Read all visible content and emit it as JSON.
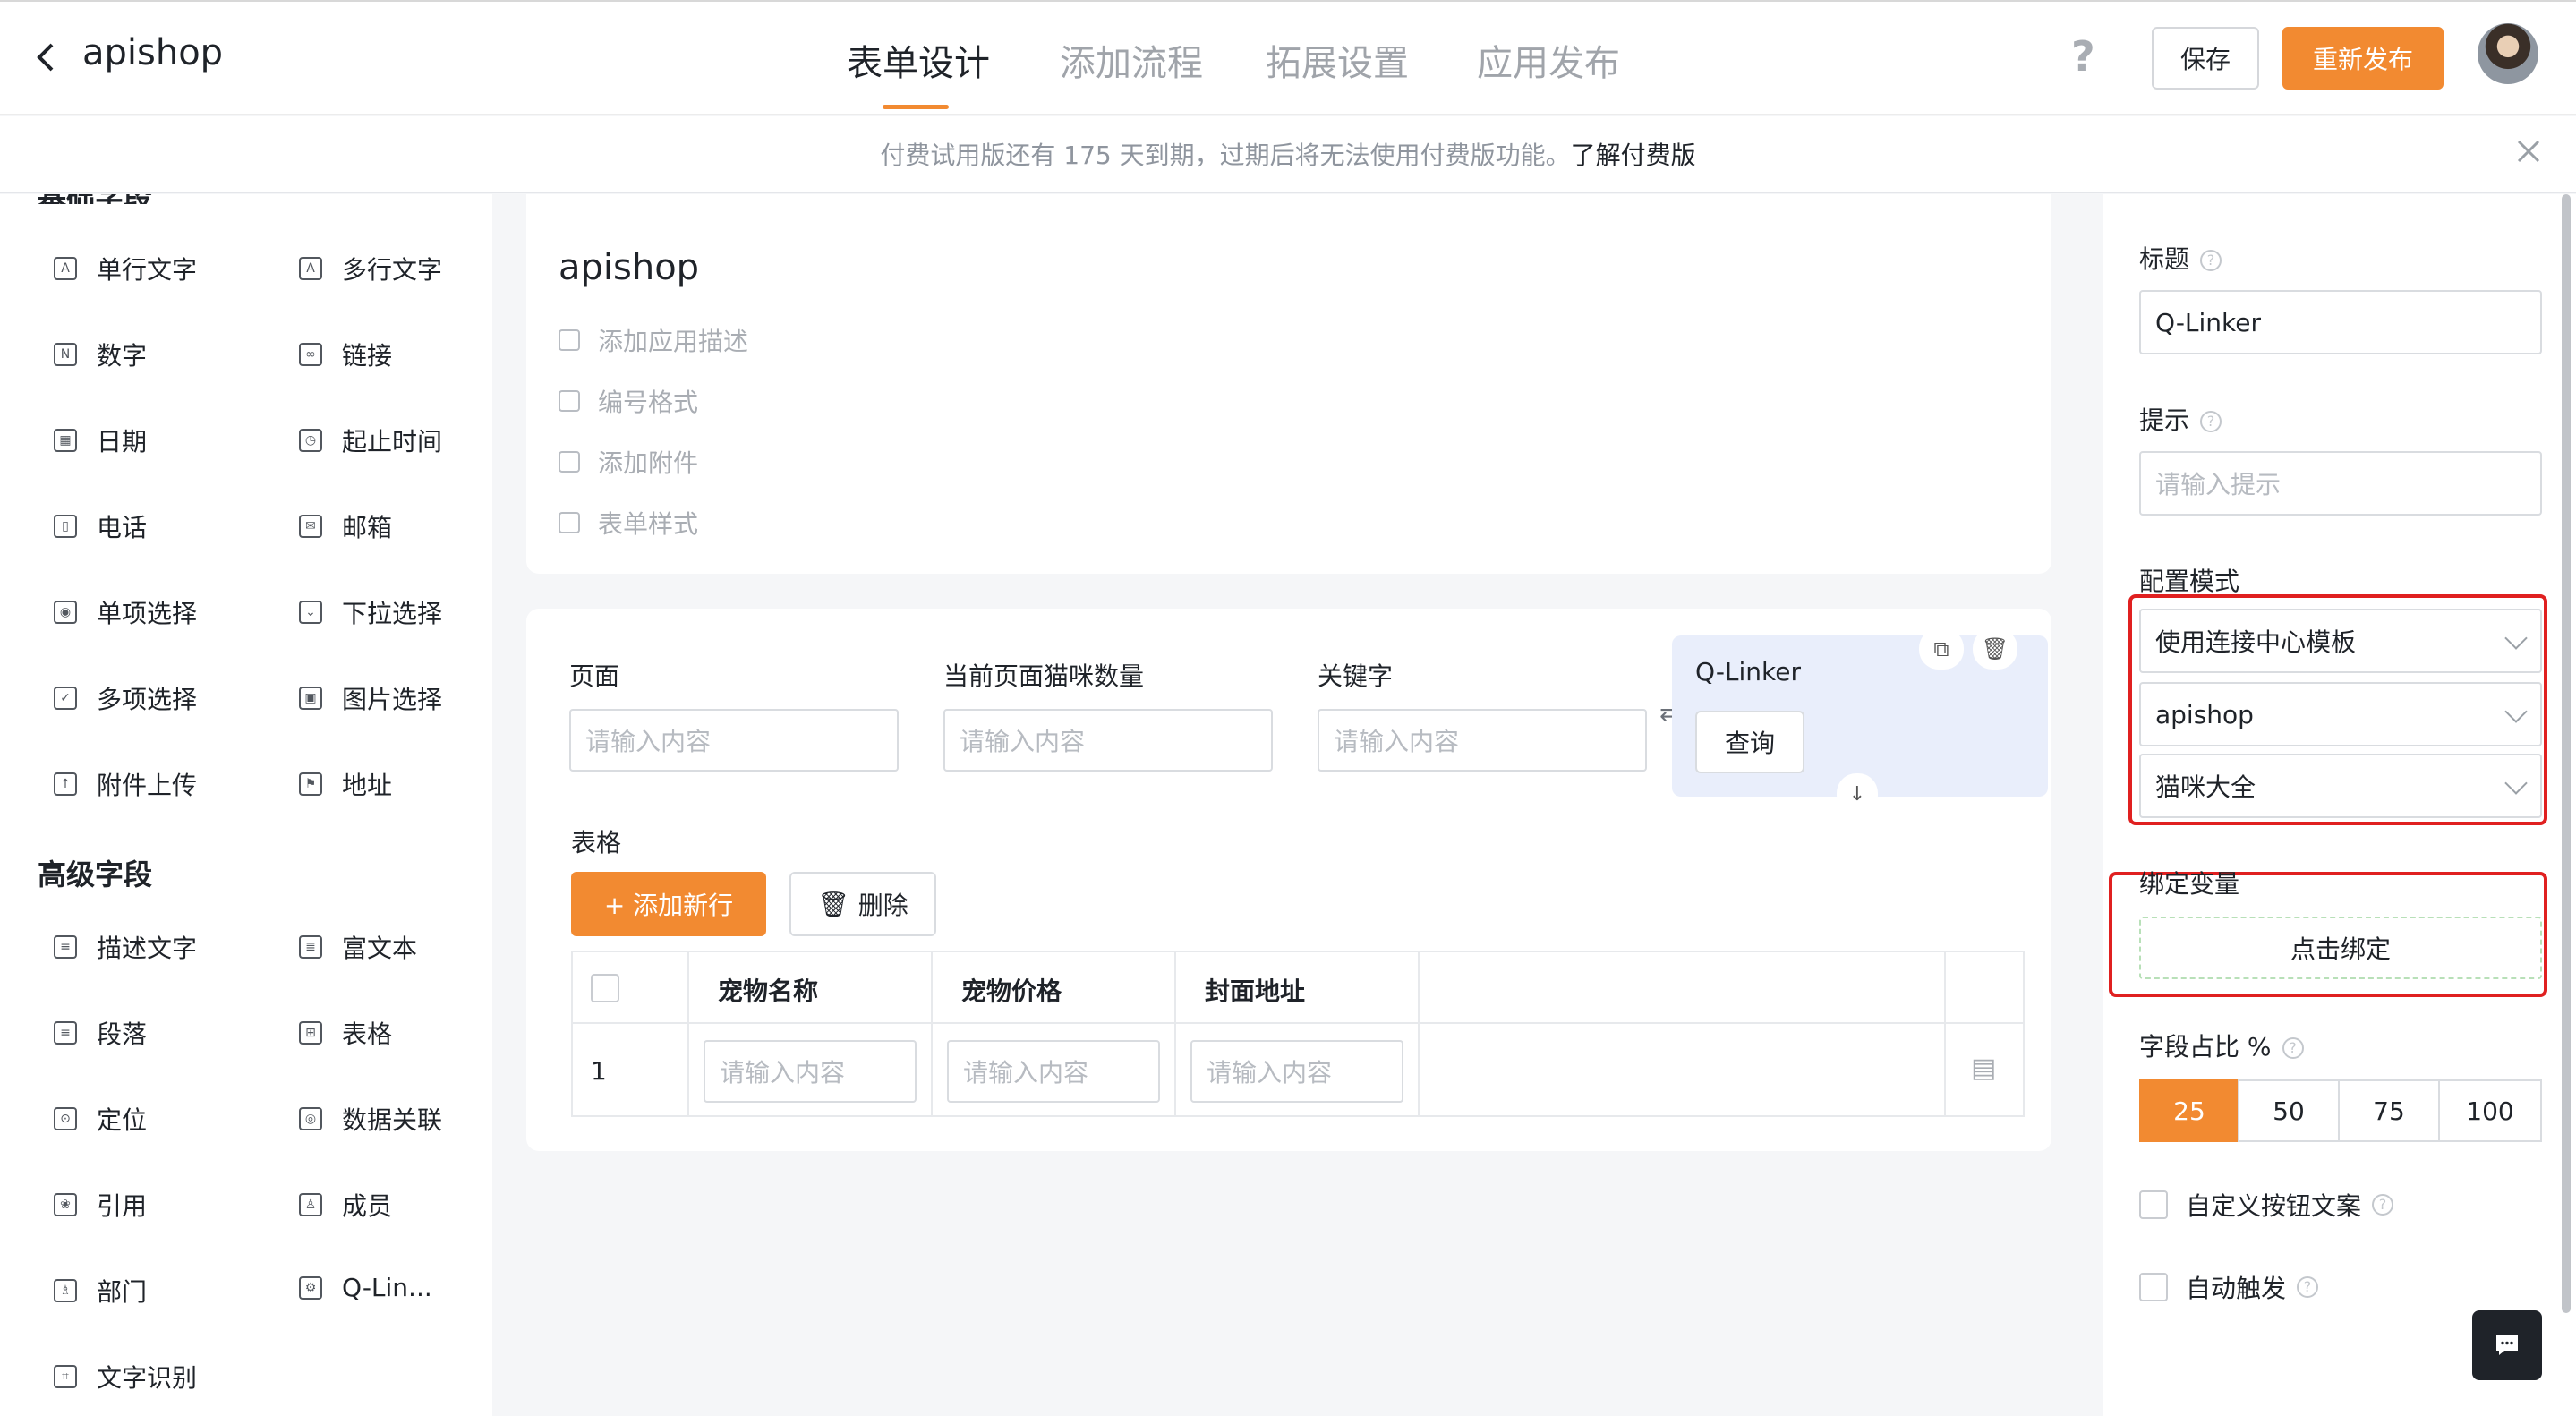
{
  "header": {
    "app_name": "apishop",
    "tabs": [
      {
        "label": "表单设计",
        "active": true
      },
      {
        "label": "添加流程",
        "active": false
      },
      {
        "label": "拓展设置",
        "active": false
      },
      {
        "label": "应用发布",
        "active": false
      }
    ],
    "help_glyph": "?",
    "save_label": "保存",
    "publish_label": "重新发布"
  },
  "notice": {
    "text": "付费试用版还有 175 天到期，过期后将无法使用付费版功能。",
    "link": "了解付费版"
  },
  "left_panel": {
    "basic_title": "基础字段",
    "basic_fields": [
      {
        "label": "单行文字",
        "icon": "A"
      },
      {
        "label": "多行文字",
        "icon": "A"
      },
      {
        "label": "数字",
        "icon": "N"
      },
      {
        "label": "链接",
        "icon": "∞"
      },
      {
        "label": "日期",
        "icon": "▦"
      },
      {
        "label": "起止时间",
        "icon": "◷"
      },
      {
        "label": "电话",
        "icon": "▯"
      },
      {
        "label": "邮箱",
        "icon": "✉"
      },
      {
        "label": "单项选择",
        "icon": "◉"
      },
      {
        "label": "下拉选择",
        "icon": "⌄"
      },
      {
        "label": "多项选择",
        "icon": "✓"
      },
      {
        "label": "图片选择",
        "icon": "▣"
      },
      {
        "label": "附件上传",
        "icon": "↑"
      },
      {
        "label": "地址",
        "icon": "⚑"
      }
    ],
    "advanced_title": "高级字段",
    "advanced_fields": [
      {
        "label": "描述文字",
        "icon": "≡"
      },
      {
        "label": "富文本",
        "icon": "≣"
      },
      {
        "label": "段落",
        "icon": "≡"
      },
      {
        "label": "表格",
        "icon": "⊞"
      },
      {
        "label": "定位",
        "icon": "⊙"
      },
      {
        "label": "数据关联",
        "icon": "◎"
      },
      {
        "label": "引用",
        "icon": "❀"
      },
      {
        "label": "成员",
        "icon": "♙"
      },
      {
        "label": "部门",
        "icon": "♗"
      },
      {
        "label": "Q-Lin...",
        "icon": "⚙"
      },
      {
        "label": "文字识别",
        "icon": "⌗"
      }
    ]
  },
  "form": {
    "title": "apishop",
    "meta": [
      "添加应用描述",
      "编号格式",
      "添加附件",
      "表单样式"
    ],
    "fields": [
      {
        "label": "页面",
        "placeholder": "请输入内容"
      },
      {
        "label": "当前页面猫咪数量",
        "placeholder": "请输入内容"
      },
      {
        "label": "关键字",
        "placeholder": "请输入内容"
      }
    ],
    "linker": {
      "label": "Q-Linker",
      "query_label": "查询"
    },
    "table_label": "表格",
    "add_row_label": "+ 添加新行",
    "delete_label": "删除",
    "columns": [
      "宠物名称",
      "宠物价格",
      "封面地址"
    ],
    "row_index": "1",
    "cell_placeholder": "请输入内容"
  },
  "right_panel": {
    "title_label": "标题",
    "title_value": "Q-Linker",
    "hint_label": "提示",
    "hint_placeholder": "请输入提示",
    "config_label": "配置模式",
    "config_selects": [
      "使用连接中心模板",
      "apishop",
      "猫咪大全"
    ],
    "bind_label": "绑定变量",
    "bind_button": "点击绑定",
    "ratio_label": "字段占比 %",
    "ratio_options": [
      "25",
      "50",
      "75",
      "100"
    ],
    "ratio_selected": "25",
    "custom_button_text": "自定义按钮文案",
    "auto_trigger": "自动触发"
  },
  "colors": {
    "accent": "#f28a31",
    "highlight": "#e02020",
    "linker_bg": "#e9eefb"
  }
}
